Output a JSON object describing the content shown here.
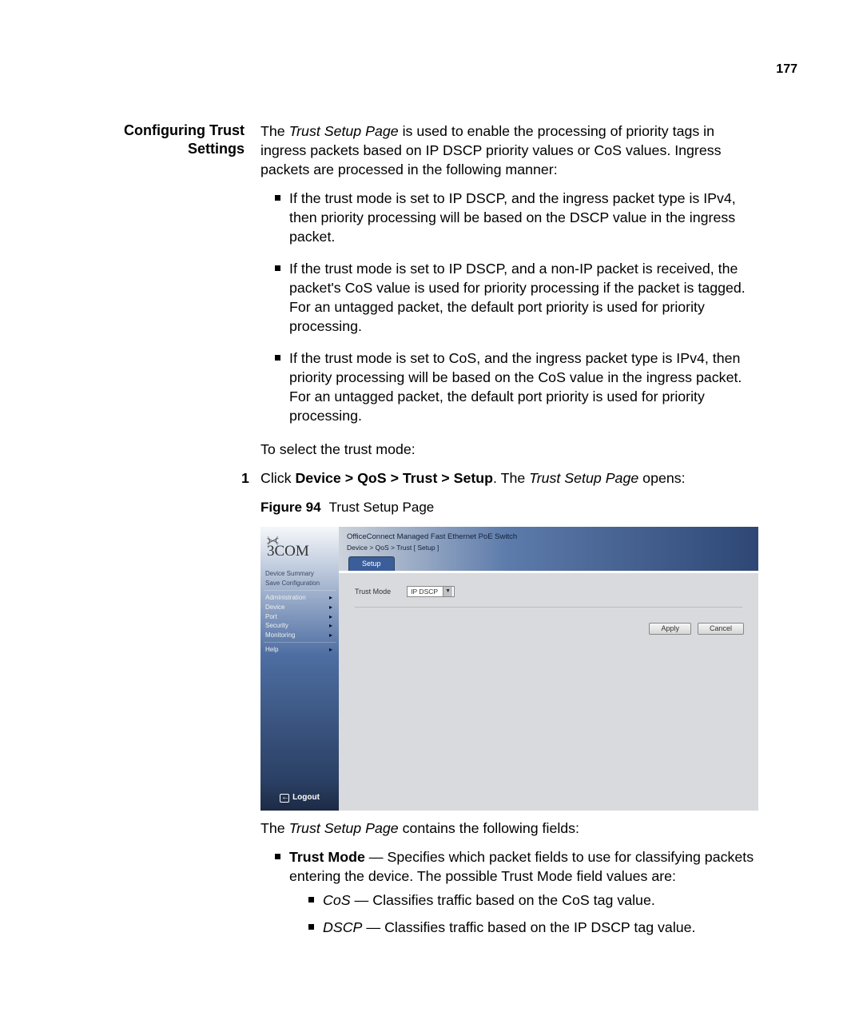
{
  "page_number": "177",
  "section_heading": "Configuring Trust Settings",
  "intro": {
    "before_italic": "The ",
    "italic": "Trust Setup Page",
    "after": " is used to enable the processing of priority tags in ingress packets based on IP DSCP priority values or CoS values. Ingress packets are processed in the following manner:"
  },
  "bullets": [
    "If the trust mode is set to IP DSCP, and the ingress packet type is IPv4, then priority processing will be based on the DSCP value in the ingress packet.",
    "If the trust mode is set to IP DSCP, and a non-IP packet is received, the packet's CoS value is used for priority processing if the packet is tagged. For an untagged packet, the default port priority is used for priority processing.",
    "If the trust mode is set to CoS, and the ingress packet type is IPv4, then priority processing will be based on the CoS value in the ingress packet. For an untagged packet, the default port priority is used for priority processing."
  ],
  "to_select": "To select the trust mode:",
  "step1": {
    "num": "1",
    "prefix": "Click ",
    "bold": "Device > QoS > Trust > Setup",
    "mid": ". The ",
    "italic": "Trust Setup Page",
    "suffix": " opens:"
  },
  "figure_caption": {
    "label": "Figure 94",
    "text": "Trust Setup Page"
  },
  "screenshot": {
    "logo": "3COM",
    "header_title": "OfficeConnect Managed Fast Ethernet PoE Switch",
    "breadcrumb": "Device > QoS > Trust [ Setup ]",
    "tab": "Setup",
    "field_label": "Trust Mode",
    "select_value": "IP DSCP",
    "apply": "Apply",
    "cancel": "Cancel",
    "nav_top": [
      "Device Summary",
      "Save Configuration"
    ],
    "nav_main": [
      "Administration",
      "Device",
      "Port",
      "Security",
      "Monitoring"
    ],
    "nav_help": "Help",
    "logout": "Logout"
  },
  "after_figure": {
    "prefix": "The ",
    "italic": "Trust Setup Page",
    "suffix": " contains the following fields:"
  },
  "fields_list": {
    "trust_mode": {
      "label": "Trust Mode",
      "desc": " — Specifies which packet fields to use for classifying packets entering the device. The possible Trust Mode field values are:"
    },
    "values": [
      {
        "name": "CoS",
        "desc": " — Classifies traffic based on the CoS tag value."
      },
      {
        "name": "DSCP",
        "desc": " — Classifies traffic based on the IP DSCP tag value."
      }
    ]
  }
}
